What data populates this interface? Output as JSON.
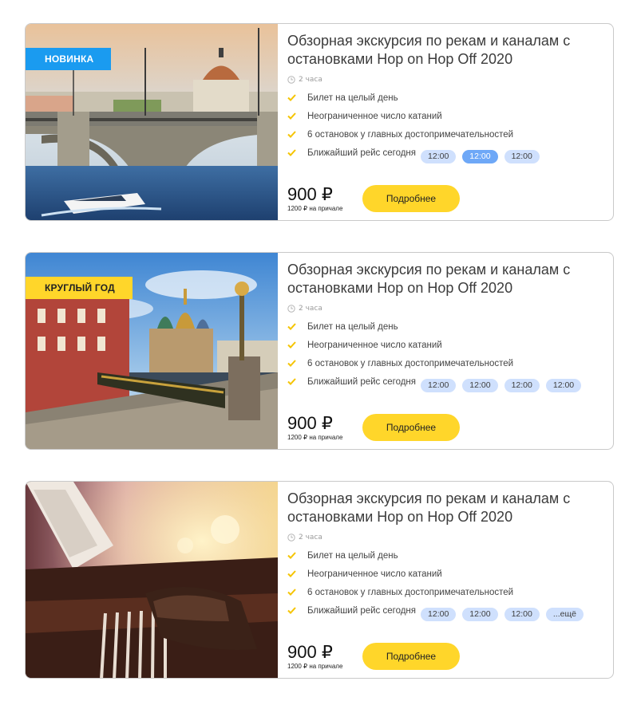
{
  "cards": [
    {
      "badge": "НОВИНКА",
      "badge_color": "#1a9bf0",
      "image": "bridge-river-speedboat",
      "title": "Обзорная экскурсия по рекам и каналам с остановками Hop on Hop Off 2020",
      "duration": "2 часа",
      "features": [
        "Билет на целый день",
        "Неограниченное число катаний",
        "6 остановок у главных достопримечательностей",
        "Ближайший рейс сегодня"
      ],
      "slots": [
        {
          "label": "12:00",
          "active": false
        },
        {
          "label": "12:00",
          "active": true
        },
        {
          "label": "12:00",
          "active": false
        }
      ],
      "price": "900 ₽",
      "price_note": "1200 ₽ на причале",
      "button": "Подробнее"
    },
    {
      "badge": "КРУГЛЫЙ ГОД",
      "badge_color": "#ffd62a",
      "image": "church-canal-embankment",
      "title": "Обзорная экскурсия по рекам и каналам с остановками Hop on Hop Off 2020",
      "duration": "2 часа",
      "features": [
        "Билет на целый день",
        "Неограниченное число катаний",
        "6 остановок у главных достопримечательностей",
        "Ближайший рейс сегодня"
      ],
      "slots": [
        {
          "label": "12:00",
          "active": false
        },
        {
          "label": "12:00",
          "active": false
        },
        {
          "label": "12:00",
          "active": false
        },
        {
          "label": "12:00",
          "active": false
        }
      ],
      "price": "900 ₽",
      "price_note": "1200 ₽ на причале",
      "button": "Подробнее"
    },
    {
      "badge": "",
      "badge_color": "",
      "image": "piano-hands",
      "title": "Обзорная экскурсия по рекам и каналам с остановками Hop on Hop Off 2020",
      "duration": "2 часа",
      "features": [
        "Билет на целый день",
        "Неограниченное число катаний",
        "6 остановок у главных достопримечательностей",
        "Ближайший рейс сегодня"
      ],
      "slots": [
        {
          "label": "12:00",
          "active": false
        },
        {
          "label": "12:00",
          "active": false
        },
        {
          "label": "12:00",
          "active": false
        },
        {
          "label": "...ещё",
          "active": false
        }
      ],
      "price": "900 ₽",
      "price_note": "1200 ₽ на причале",
      "button": "Подробнее"
    }
  ],
  "icons": {
    "clock": "clock-icon",
    "check": "check-icon"
  },
  "colors": {
    "accent_yellow": "#ffd62a",
    "accent_blue": "#1a9bf0",
    "slot_bg": "#cfe0fd",
    "slot_active_bg": "#6ea8f7",
    "check_color": "#f5c400"
  }
}
